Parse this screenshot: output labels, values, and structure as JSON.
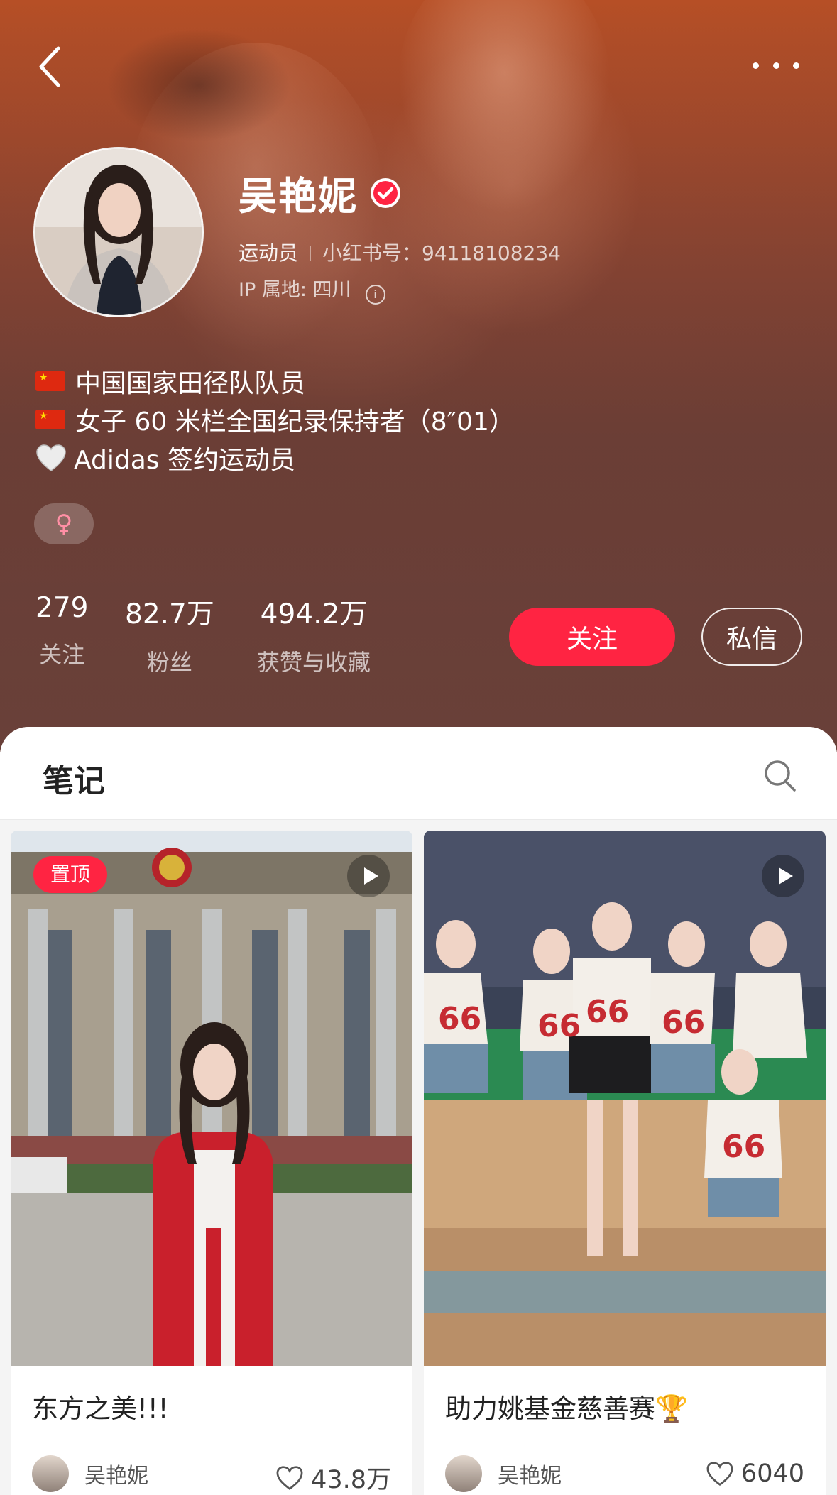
{
  "profile": {
    "name": "吴艳妮",
    "occupation": "运动员",
    "redbook_id_label": "小红书号：",
    "redbook_id": "94118108234",
    "ip_location": "IP 属地: 四川",
    "bio": [
      "中国国家田径队队员",
      "女子 60 米栏全国纪录保持者（8″01）",
      "Adidas 签约运动员"
    ],
    "gender_symbol": "♀"
  },
  "stats": [
    {
      "value": "279",
      "label": "关注"
    },
    {
      "value": "82.7万",
      "label": "粉丝"
    },
    {
      "value": "494.2万",
      "label": "获赞与收藏"
    }
  ],
  "actions": {
    "follow": "关注",
    "message": "私信"
  },
  "notes": {
    "section_title": "笔记",
    "items": [
      {
        "pinned_label": "置顶",
        "title": "东方之美!!!",
        "author": "吴艳妮",
        "likes": "43.8万",
        "is_video": true
      },
      {
        "title": "助力姚基金慈善赛🏆",
        "author": "吴艳妮",
        "likes": "6040",
        "is_video": true
      }
    ]
  },
  "icons": {
    "back": "chevron-left-icon",
    "more": "more-dots-icon",
    "verified": "verified-badge-icon",
    "search": "search-icon",
    "like": "heart-outline-icon",
    "play": "play-icon"
  },
  "colors": {
    "brand_red": "#ff2442",
    "hero_top": "#b64f26",
    "hero_bottom": "#6a4039"
  }
}
